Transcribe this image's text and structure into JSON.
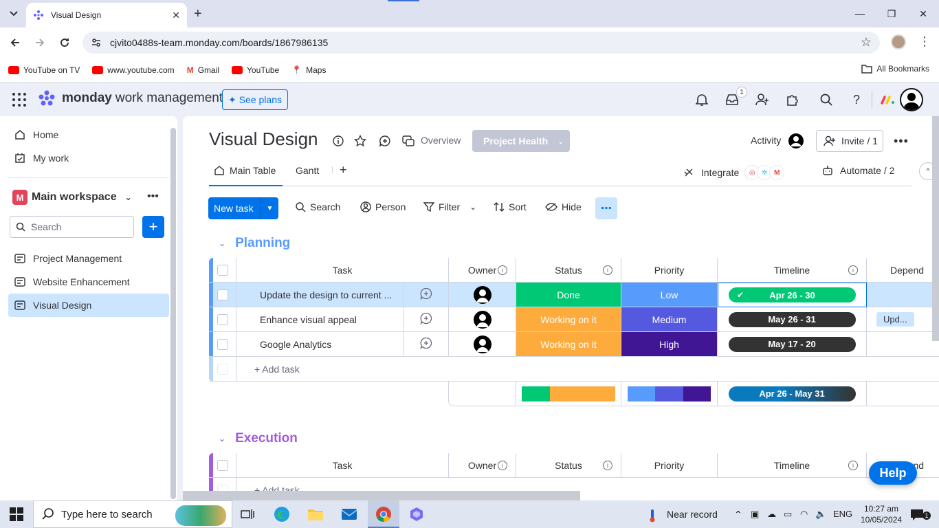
{
  "browser": {
    "tab_title": "Visual Design",
    "url": "cjvito0488s-team.monday.com/boards/1867986135",
    "bookmarks": [
      "YouTube on TV",
      "www.youtube.com",
      "Gmail",
      "YouTube",
      "Maps"
    ],
    "all_bookmarks": "All Bookmarks"
  },
  "app": {
    "logo_bold": "monday",
    "logo_light": "work management",
    "see_plans": "See plans",
    "inbox_badge": "1"
  },
  "sidebar": {
    "home": "Home",
    "my_work": "My work",
    "workspace_initial": "M",
    "workspace": "Main workspace",
    "search_placeholder": "Search",
    "boards": [
      "Project Management",
      "Website Enhancement",
      "Visual Design"
    ]
  },
  "board": {
    "title": "Visual Design",
    "overview": "Overview",
    "project_health": "Project Health",
    "activity": "Activity",
    "invite": "Invite / 1",
    "tabs": [
      "Main Table",
      "Gantt"
    ],
    "integrate": "Integrate",
    "automate": "Automate / 2",
    "toolbar": {
      "new_task": "New task",
      "search": "Search",
      "person": "Person",
      "filter": "Filter",
      "sort": "Sort",
      "hide": "Hide"
    },
    "columns": {
      "task": "Task",
      "owner": "Owner",
      "status": "Status",
      "priority": "Priority",
      "timeline": "Timeline",
      "dependency": "Depend"
    },
    "groups": [
      {
        "name": "Planning",
        "color": "#579bfc",
        "rows": [
          {
            "task": "Update the design to current ...",
            "status": "Done",
            "priority": "Low",
            "timeline": "Apr 26 - 30",
            "dependency": ""
          },
          {
            "task": "Enhance visual appeal",
            "status": "Working on it",
            "priority": "Medium",
            "timeline": "May 26 - 31",
            "dependency": "Upd..."
          },
          {
            "task": "Google Analytics",
            "status": "Working on it",
            "priority": "High",
            "timeline": "May 17 - 20",
            "dependency": ""
          }
        ],
        "add_task": "+ Add task",
        "summary_timeline": "Apr 26 - May 31"
      },
      {
        "name": "Execution",
        "color": "#a25ddc",
        "add_task": "+ Add task"
      }
    ],
    "help": "Help"
  },
  "colors": {
    "done": "#00c875",
    "working": "#fdab3d",
    "low": "#579bfc",
    "medium": "#5559df",
    "high": "#401694",
    "timeline_dark": "#333333",
    "primary": "#0073ea"
  },
  "taskbar": {
    "search_placeholder": "Type here to search",
    "weather": "Near record",
    "lang": "ENG",
    "time": "10:27 am",
    "date": "10/05/2024",
    "notif_count": "1"
  }
}
